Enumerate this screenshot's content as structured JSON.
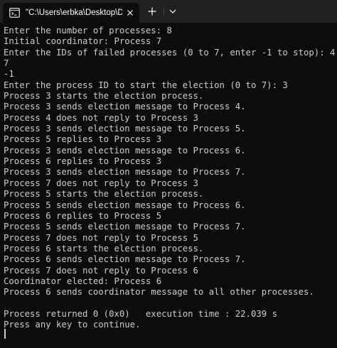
{
  "tab": {
    "title": "\"C:\\Users\\erbka\\Desktop\\Dist",
    "icon": "terminal-icon",
    "close_icon": "close-icon"
  },
  "toolbar": {
    "new_tab_icon": "plus-icon",
    "dropdown_icon": "chevron-down-icon"
  },
  "console": {
    "lines": [
      "Enter the number of processes: 8",
      "Initial coordinator: Process 7",
      "Enter the IDs of failed processes (0 to 7, enter -1 to stop): 4",
      "7",
      "-1",
      "Enter the process ID to start the election (0 to 7): 3",
      "Process 3 starts the election process.",
      "Process 3 sends election message to Process 4.",
      "Process 4 does not reply to Process 3",
      "Process 3 sends election message to Process 5.",
      "Process 5 replies to Process 3",
      "Process 3 sends election message to Process 6.",
      "Process 6 replies to Process 3",
      "Process 3 sends election message to Process 7.",
      "Process 7 does not reply to Process 3",
      "Process 5 starts the election process.",
      "Process 5 sends election message to Process 6.",
      "Process 6 replies to Process 5",
      "Process 5 sends election message to Process 7.",
      "Process 7 does not reply to Process 5",
      "Process 6 starts the election process.",
      "Process 6 sends election message to Process 7.",
      "Process 7 does not reply to Process 6",
      "Coordinator elected: Process 6",
      "Process 6 sends coordinator message to all other processes.",
      "",
      "Process returned 0 (0x0)   execution time : 22.039 s",
      "Press any key to continue."
    ]
  },
  "colors": {
    "background": "#0c0c0c",
    "titlebar": "#202020",
    "text": "#cccccc"
  }
}
